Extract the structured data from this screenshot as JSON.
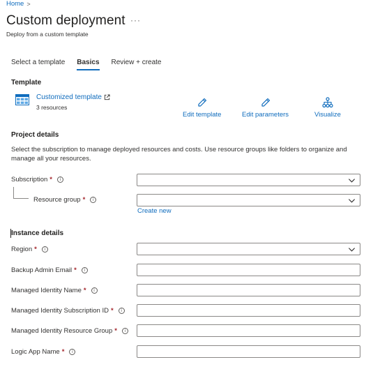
{
  "breadcrumb": {
    "home": "Home",
    "separator": ">"
  },
  "page": {
    "title": "Custom deployment",
    "more": "···",
    "subtitle": "Deploy from a custom template"
  },
  "tabs": [
    {
      "label": "Select a template"
    },
    {
      "label": "Basics"
    },
    {
      "label": "Review + create"
    }
  ],
  "template": {
    "heading": "Template",
    "name": "Customized template",
    "resources": "3 resources",
    "actions": {
      "edit_template": "Edit template",
      "edit_parameters": "Edit parameters",
      "visualize": "Visualize"
    }
  },
  "project": {
    "heading": "Project details",
    "description": "Select the subscription to manage deployed resources and costs. Use resource groups like folders to organize and manage all your resources.",
    "subscription_label": "Subscription",
    "resource_group_label": "Resource group",
    "create_new": "Create new"
  },
  "instance": {
    "heading": "Instance details",
    "region_label": "Region",
    "backup_email_label": "Backup Admin Email",
    "mi_name_label": "Managed Identity Name",
    "mi_sub_label": "Managed Identity Subscription ID",
    "mi_rg_label": "Managed Identity Resource Group",
    "logic_app_label": "Logic App Name"
  },
  "markers": {
    "required": "*",
    "info": "i"
  },
  "colors": {
    "accent": "#0f6cbd",
    "required": "#a4262c",
    "border": "#8a8886"
  }
}
